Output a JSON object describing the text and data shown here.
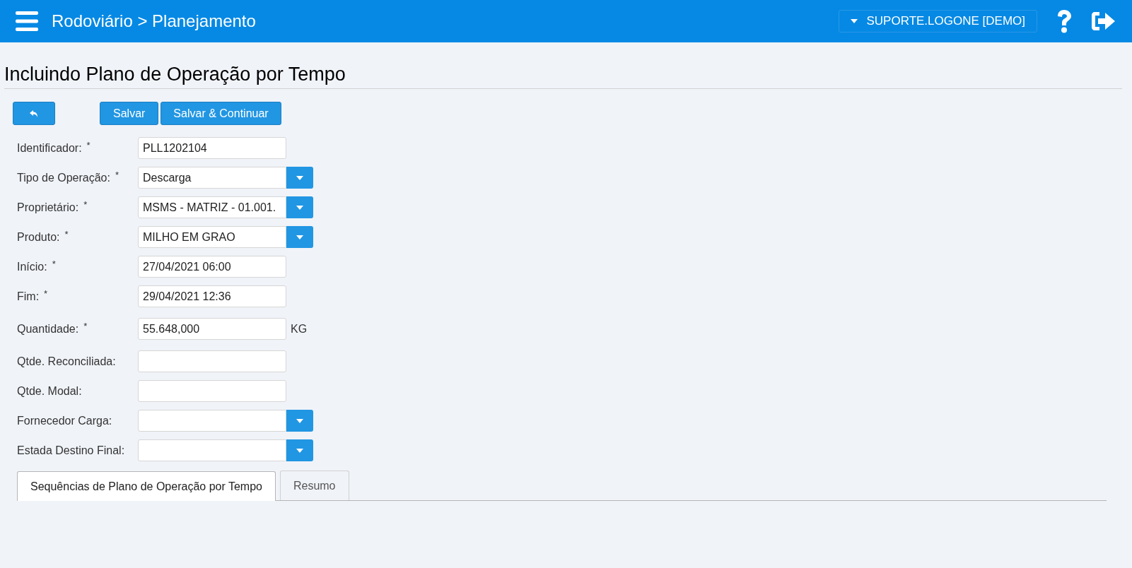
{
  "header": {
    "breadcrumb": "Rodoviário > Planejamento",
    "user": "SUPORTE.LOGONE [DEMO]"
  },
  "page_title": "Incluindo Plano de Operação por Tempo",
  "toolbar": {
    "save": "Salvar",
    "save_continue": "Salvar & Continuar"
  },
  "sections": [
    [
      {
        "kind": "text",
        "label": "Identificador:",
        "required_mark": "*",
        "value": "PLL1202104"
      },
      {
        "kind": "select",
        "label": "Tipo de Operação:",
        "required_mark": "*",
        "value": "Descarga"
      },
      {
        "kind": "select",
        "label": "Proprietário:",
        "required_mark": "*",
        "value": "MSMS - MATRIZ - 01.001."
      },
      {
        "kind": "select",
        "label": "Produto:",
        "required_mark": "*",
        "value": "MILHO EM GRAO"
      },
      {
        "kind": "text",
        "label": "Início:",
        "required_mark": "*",
        "value": "27/04/2021 06:00"
      },
      {
        "kind": "text",
        "label": "Fim:",
        "required_mark": "*",
        "value": "29/04/2021 12:36"
      }
    ],
    [
      {
        "kind": "text",
        "label": "Quantidade:",
        "required_mark": "*",
        "value": "55.648,000",
        "unit": "KG"
      }
    ],
    [
      {
        "kind": "text",
        "label": "Qtde. Reconciliada:"
      },
      {
        "kind": "text",
        "label": "Qtde. Modal:"
      },
      {
        "kind": "select",
        "label": "Fornecedor Carga:"
      },
      {
        "kind": "select",
        "label": "Estada Destino Final:"
      }
    ]
  ],
  "tabs": [
    {
      "label": "Sequências de Plano de Operação por Tempo",
      "selected": true
    },
    {
      "label": "Resumo",
      "selected": false
    }
  ]
}
